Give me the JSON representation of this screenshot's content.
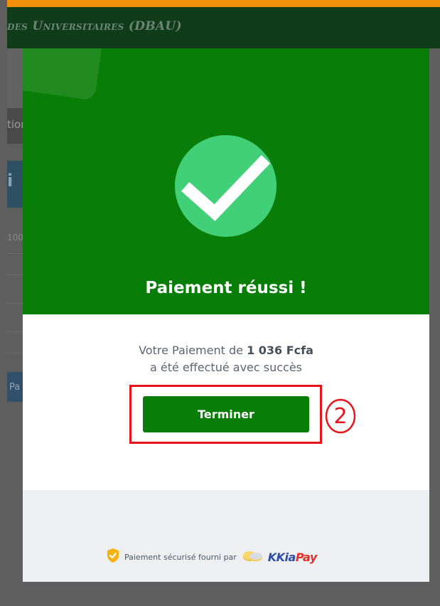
{
  "background": {
    "header_title": "des Universitaires (DBAU)",
    "nav_partial_text": "tion",
    "tile_letter": "i",
    "row_number_partial": "100",
    "button_partial_text": "Pa"
  },
  "modal": {
    "title": "Paiement réussi !",
    "message_prefix": "Votre Paiement de",
    "amount": "1 036 Fcfa",
    "message_line2": "a été effectué avec succès",
    "button_label": "Terminer",
    "footer": {
      "secure_text": "Paiement sécurisé fourni par",
      "brand_kk": "KKia",
      "brand_pay": "Pay"
    }
  },
  "annotation": {
    "step_number": "2"
  },
  "colors": {
    "modal_green": "#087e08",
    "check_circle": "#41d078",
    "annotation_red": "#e8141c",
    "header_orange": "#f0900a",
    "brand_blue": "#2c4fa3",
    "brand_red": "#e0312b"
  },
  "icons": [
    "check-icon",
    "shield-icon",
    "coins-icon"
  ]
}
